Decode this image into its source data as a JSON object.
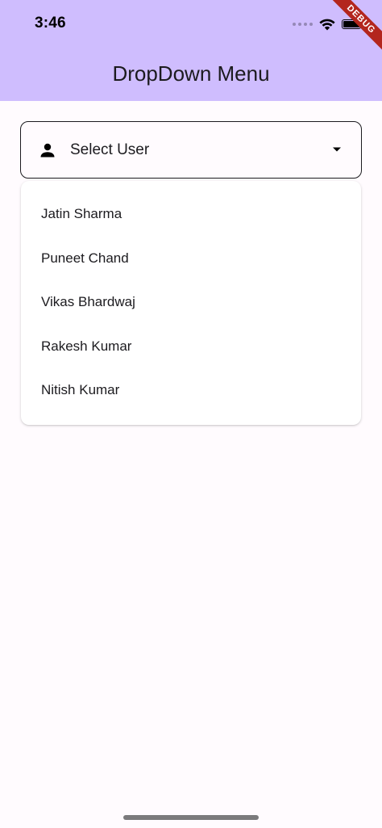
{
  "status_bar": {
    "time": "3:46"
  },
  "debug_banner": {
    "label": "DEBUG"
  },
  "app_bar": {
    "title": "DropDown Menu"
  },
  "dropdown": {
    "label": "Select User",
    "leading_icon": "person-icon",
    "trailing_icon": "arrow-drop-down-icon"
  },
  "menu": {
    "items": [
      {
        "label": "Jatin Sharma"
      },
      {
        "label": "Puneet Chand"
      },
      {
        "label": "Vikas Bhardwaj"
      },
      {
        "label": "Rakesh Kumar"
      },
      {
        "label": "Nitish Kumar"
      }
    ]
  },
  "colors": {
    "app_bar_bg": "#cfbdfe",
    "page_bg": "#fffbfe",
    "menu_bg": "#ffffff",
    "text": "#1c1b1f",
    "debug_ribbon": "#b3261e"
  }
}
